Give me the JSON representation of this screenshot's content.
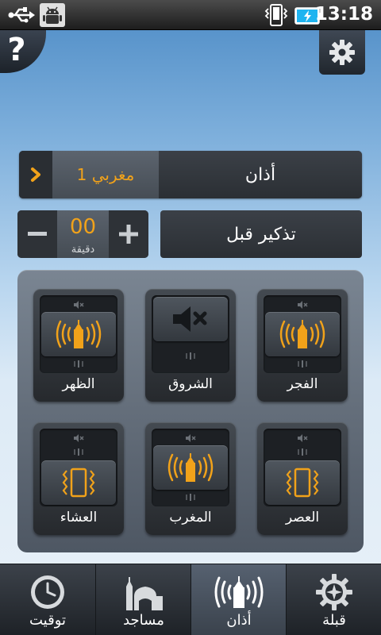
{
  "status_bar": {
    "time": "13:18",
    "icons": [
      "usb-icon",
      "android-debug-icon",
      "phone-vibrate-icon",
      "battery-charging-icon"
    ]
  },
  "header": {
    "help_label": "?",
    "settings_icon": "gear-icon"
  },
  "azan": {
    "label": "أذان",
    "selected": "مغربي 1",
    "arrow_icon": "chevron-left-icon"
  },
  "reminder": {
    "label": "تذكير قبل",
    "value": "00",
    "unit": "دقيقة",
    "minus": "−",
    "plus": "+"
  },
  "prayers": [
    {
      "name": "الظهر",
      "mode": "azan"
    },
    {
      "name": "الشروق",
      "mode": "mute"
    },
    {
      "name": "الفجر",
      "mode": "azan"
    },
    {
      "name": "العشاء",
      "mode": "vibrate"
    },
    {
      "name": "المغرب",
      "mode": "azan"
    },
    {
      "name": "العصر",
      "mode": "vibrate"
    }
  ],
  "bottom_nav": {
    "tabs": [
      {
        "label": "توقيت",
        "icon": "clock-icon"
      },
      {
        "label": "مساجد",
        "icon": "mosque-icon"
      },
      {
        "label": "أذان",
        "icon": "azan-icon",
        "active": true
      },
      {
        "label": "قبلة",
        "icon": "compass-icon"
      }
    ]
  },
  "colors": {
    "accent": "#f1a21a",
    "panel": "#5e6874",
    "sky_top": "#4e8cc6"
  }
}
